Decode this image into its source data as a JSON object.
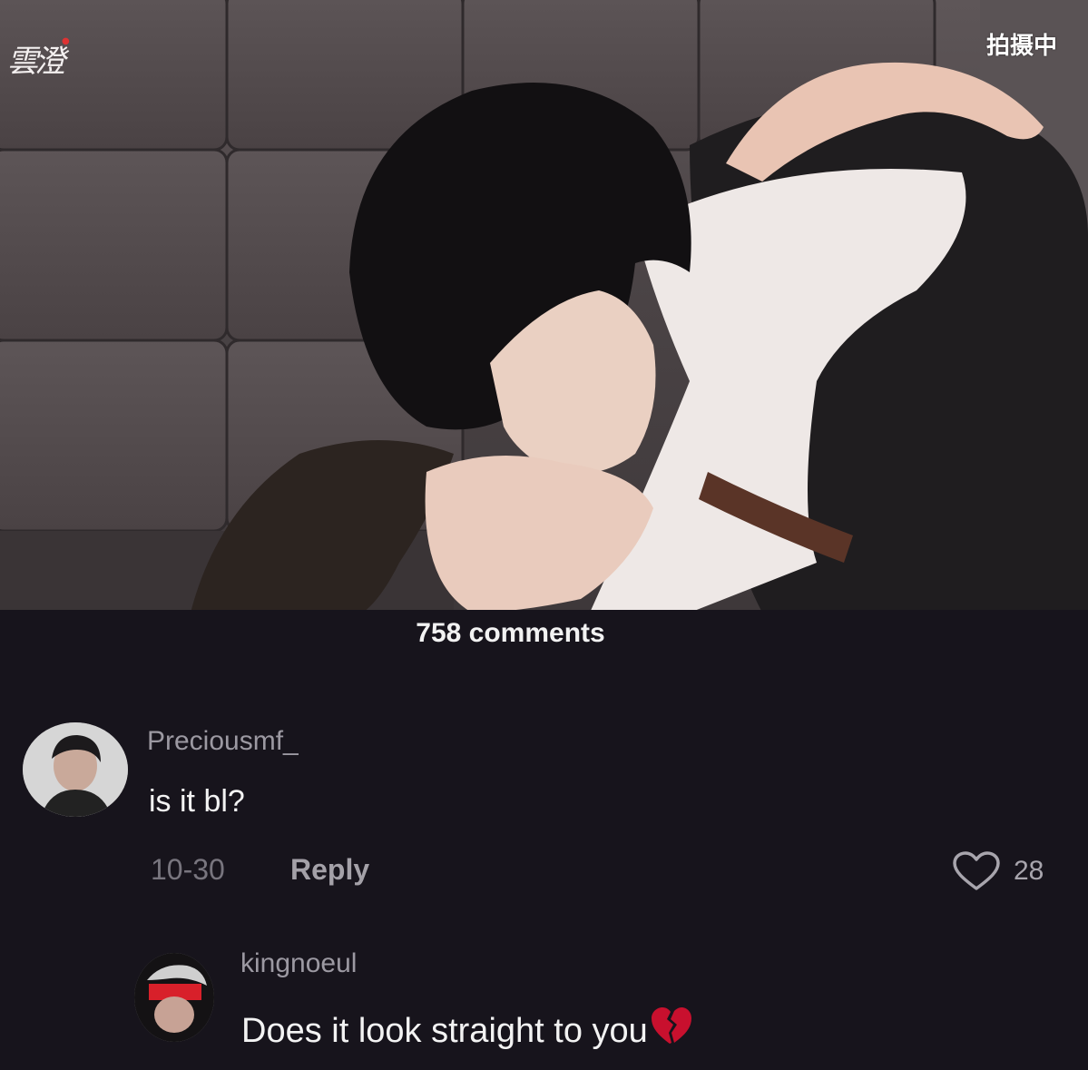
{
  "video": {
    "watermark_logo": "雲澄",
    "status_label": "拍摄中"
  },
  "comments_header": {
    "count_label": "758 comments"
  },
  "comments": [
    {
      "username": "Preciousmf_",
      "text": "is it bl?",
      "date": "10-30",
      "reply_label": "Reply",
      "like_count": "28",
      "like_icon": "heart-outline-icon"
    },
    {
      "username": "kingnoeul",
      "text": "Does it look straight to you",
      "emoji": "broken-heart-icon"
    }
  ],
  "colors": {
    "background": "#17141c",
    "username": "#9c99a2",
    "comment_text": "#f3f3f3",
    "broken_heart": "#c8102e"
  }
}
